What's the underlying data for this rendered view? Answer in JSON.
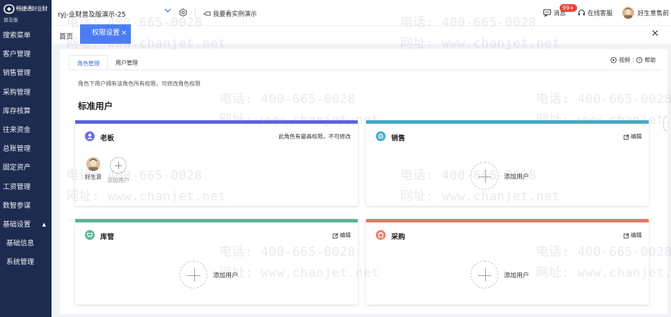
{
  "sidebar": {
    "logo_text": "畅捷通好业财",
    "logo_sub": "普及版",
    "items": [
      {
        "label": "搜索菜单"
      },
      {
        "label": "客户管理"
      },
      {
        "label": "销售管理"
      },
      {
        "label": "采购管理"
      },
      {
        "label": "库存核算"
      },
      {
        "label": "往来资金"
      },
      {
        "label": "总账管理"
      },
      {
        "label": "固定资产"
      },
      {
        "label": "工资管理"
      },
      {
        "label": "数智参谋"
      }
    ],
    "open_group": {
      "label": "基础设置",
      "caret": "▲"
    },
    "sub_items": [
      {
        "label": "基础信息"
      },
      {
        "label": "系统管理"
      }
    ]
  },
  "topbar": {
    "account_name": "ryj-业财普及版演示-25",
    "demo_label": "我要看实例演示",
    "message_label": "消息",
    "message_badge": "99+",
    "service_label": "在线客服",
    "user_name": "好生意售前"
  },
  "tabs": {
    "home_label": "首页",
    "active_label": "权限设置",
    "active_close": "×",
    "close_all": "×"
  },
  "page": {
    "subtabs": [
      {
        "label": "角色管理",
        "active": true
      },
      {
        "label": "用户管理",
        "active": false
      }
    ],
    "video_label": "视频",
    "help_label": "帮助",
    "hint": "角色下用户拥有该角色所有权限，可修改角色权限",
    "section_title": "标准用户",
    "add_user_label": "添加用户",
    "edit_label": "编辑",
    "cards": [
      {
        "name": "老板",
        "color": "#5b5fe6",
        "icon_bg": "#6a6de8",
        "note": "此角色有最高权限，不可修改",
        "members": [
          {
            "name": "好生意"
          }
        ]
      },
      {
        "name": "销售",
        "color": "#43a9c4",
        "icon_bg": "#4aaecd"
      },
      {
        "name": "库管",
        "color": "#5ab592",
        "icon_bg": "#5cb896"
      },
      {
        "name": "采购",
        "color": "#e97766",
        "icon_bg": "#ec7e6d"
      }
    ]
  },
  "watermark": {
    "phone": "电话: 400-665-0028",
    "site": "网址: www.chanjet.net"
  },
  "colors": {
    "sidebar_bg": "#1d2b4f",
    "accent": "#4b7cf3",
    "badge": "#f1403c"
  }
}
